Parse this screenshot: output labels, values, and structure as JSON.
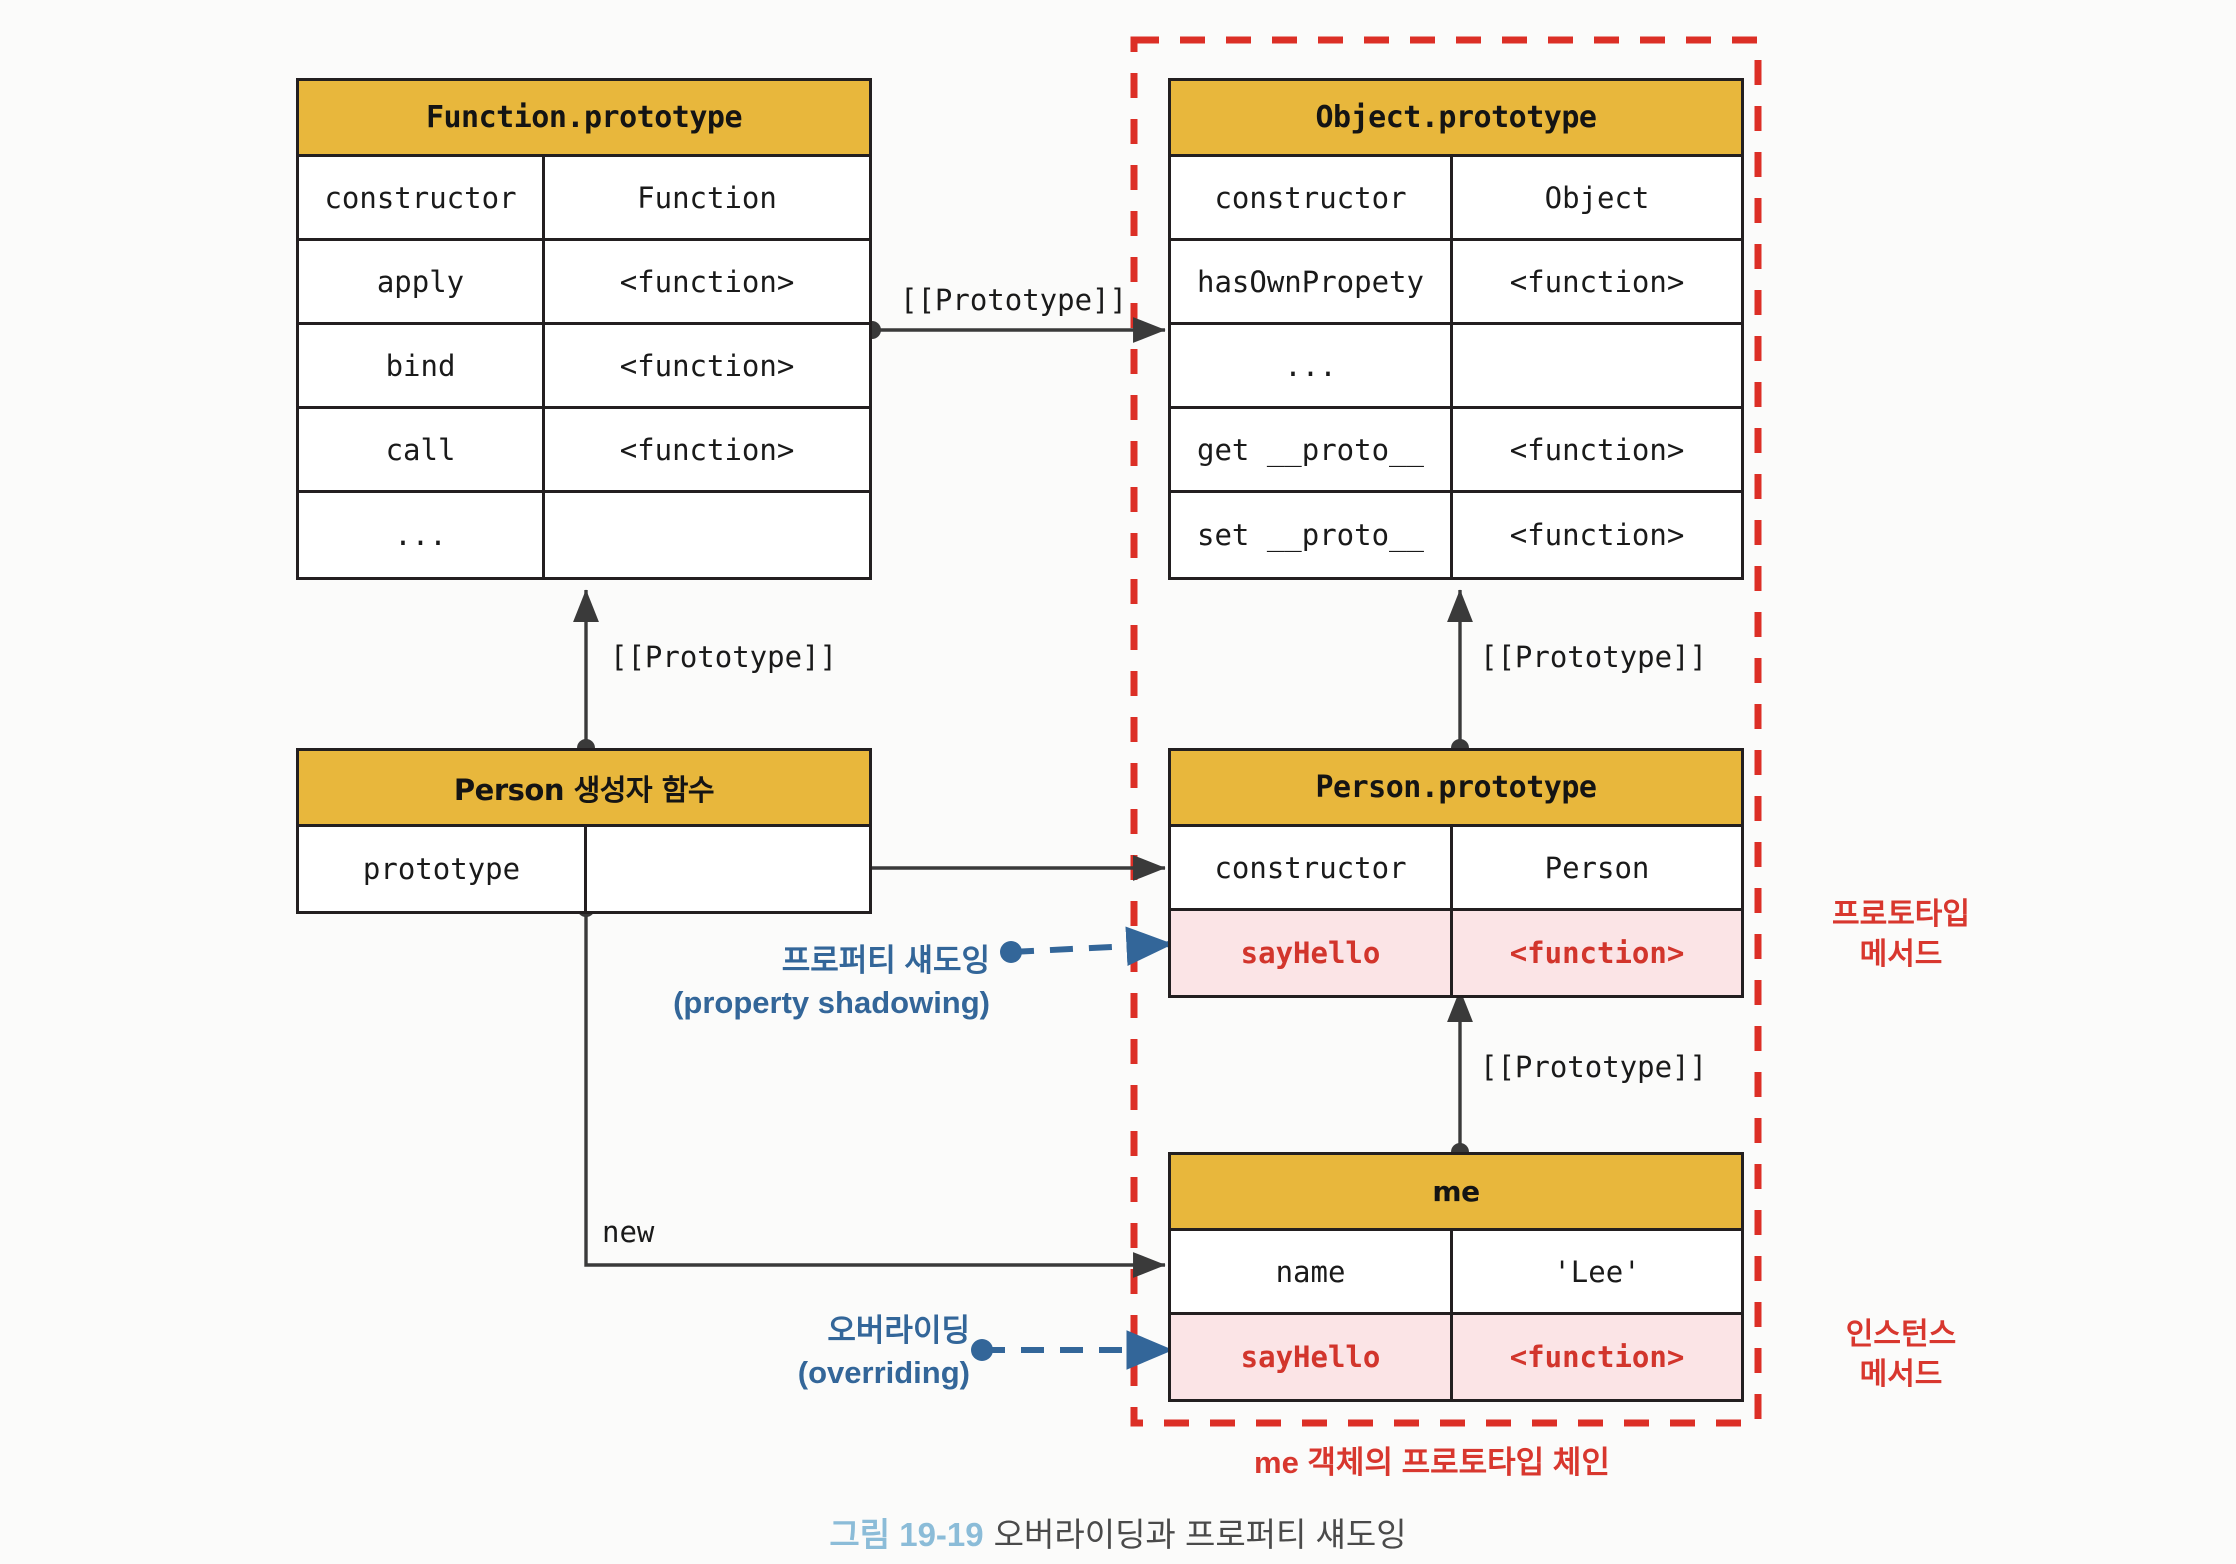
{
  "caption": {
    "figure_number": "그림 19-19",
    "figure_title": "오버라이딩과 프로퍼티 섀도잉"
  },
  "colors": {
    "header_fill": "#e8b73c",
    "highlight_fill": "#fbe4e6",
    "highlight_text": "#d2352c",
    "blue_annotation": "#336699",
    "red_annotation": "#d8372e",
    "dashed_box": "#dc2f26",
    "caption_figno": "#8bbcd8",
    "border": "#231f20"
  },
  "tables": {
    "function_prototype": {
      "title": "Function.prototype",
      "rows": [
        {
          "key": "constructor",
          "value": "Function",
          "highlight": false
        },
        {
          "key": "apply",
          "value": "<function>",
          "highlight": false
        },
        {
          "key": "bind",
          "value": "<function>",
          "highlight": false
        },
        {
          "key": "call",
          "value": "<function>",
          "highlight": false
        },
        {
          "key": "...",
          "value": "",
          "highlight": false
        }
      ]
    },
    "object_prototype": {
      "title": "Object.prototype",
      "rows": [
        {
          "key": "constructor",
          "value": "Object",
          "highlight": false
        },
        {
          "key": "hasOwnPropety",
          "value": "<function>",
          "highlight": false
        },
        {
          "key": "...",
          "value": "",
          "highlight": false
        },
        {
          "key": "get __proto__",
          "value": "<function>",
          "highlight": false
        },
        {
          "key": "set __proto__",
          "value": "<function>",
          "highlight": false
        }
      ]
    },
    "person_constructor": {
      "title": "Person 생성자 함수",
      "rows": [
        {
          "key": "prototype",
          "value": "",
          "highlight": false
        }
      ]
    },
    "person_prototype": {
      "title": "Person.prototype",
      "rows": [
        {
          "key": "constructor",
          "value": "Person",
          "highlight": false
        },
        {
          "key": "sayHello",
          "value": "<function>",
          "highlight": true
        }
      ]
    },
    "me_object": {
      "title": "me",
      "rows": [
        {
          "key": "name",
          "value": "'Lee'",
          "highlight": false
        },
        {
          "key": "sayHello",
          "value": "<function>",
          "highlight": true
        }
      ]
    }
  },
  "edges": {
    "fnproto_to_objproto": "[[Prototype]]",
    "personfn_to_fnproto": "[[Prototype]]",
    "personproto_to_objproto": "[[Prototype]]",
    "me_to_personproto": "[[Prototype]]",
    "new_label": "new"
  },
  "annotations": {
    "property_shadowing": {
      "line1": "프로퍼티 섀도잉",
      "line2": "(property shadowing)"
    },
    "overriding": {
      "line1": "오버라이딩",
      "line2": "(overriding)"
    },
    "prototype_method": {
      "line1": "프로토타입",
      "line2": "메서드"
    },
    "instance_method": {
      "line1": "인스턴스",
      "line2": "메서드"
    },
    "chain_label": "me 객체의 프로토타입 체인"
  }
}
